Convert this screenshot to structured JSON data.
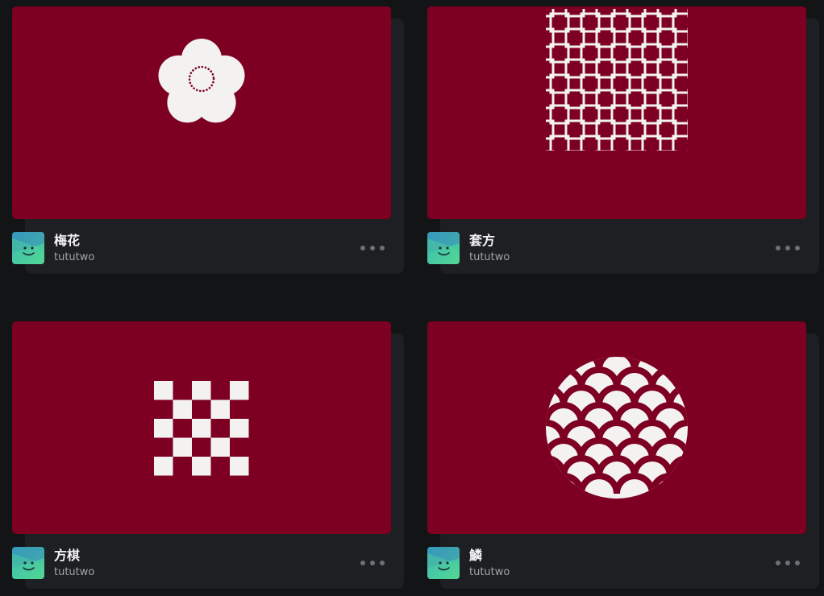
{
  "colors": {
    "page_background": "#131416",
    "card_background": "#1e1f23",
    "thumbnail_background": "#7d0022",
    "pattern": "#f4f2f1"
  },
  "cards": [
    {
      "title": "梅花",
      "author": "tututwo",
      "pattern": "plum-blossom",
      "menu_icon": "more-horizontal-icon"
    },
    {
      "title": "套方",
      "author": "tututwo",
      "pattern": "interlocking-squares",
      "menu_icon": "more-horizontal-icon"
    },
    {
      "title": "方棋",
      "author": "tututwo",
      "pattern": "checkerboard",
      "menu_icon": "more-horizontal-icon"
    },
    {
      "title": "鱗",
      "author": "tututwo",
      "pattern": "fish-scale-circle",
      "menu_icon": "more-horizontal-icon"
    }
  ]
}
